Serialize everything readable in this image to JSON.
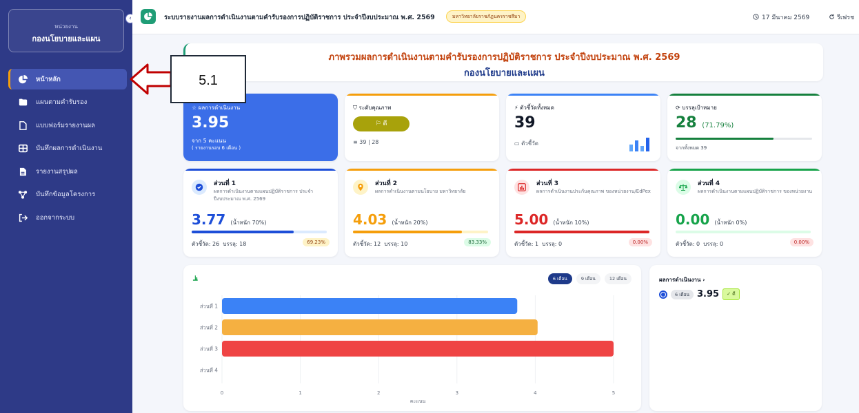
{
  "sidebar": {
    "unit_caption": "หน่วยงาน",
    "unit_name": "กองนโยบายและแผน",
    "collapse_icon": "‹",
    "items": [
      {
        "label": "หน้าหลัก",
        "icon": "pie-chart-icon",
        "active": true
      },
      {
        "label": "แผนตามคำรับรอง",
        "icon": "folder-icon"
      },
      {
        "label": "แบบฟอร์มรายงานผล",
        "icon": "document-icon"
      },
      {
        "label": "บันทึกผลการดำเนินงาน",
        "icon": "table-icon"
      },
      {
        "label": "รายงานสรุปผล",
        "icon": "report-icon"
      },
      {
        "label": "บันทึกข้อมูลโครงการ",
        "icon": "project-icon"
      },
      {
        "label": "ออกจากระบบ",
        "icon": "logout-icon"
      }
    ]
  },
  "header": {
    "title": "ระบบรายงานผลการดำเนินงานตามคำรับรองการปฏิบัติราชการ ประจำปีงบประมาณ พ.ศ. 2569",
    "university": "มหาวิทยาลัยราชภัฏนครราชสีมา",
    "date": "17 มีนาคม 2569",
    "refresh": "รีเฟรช"
  },
  "banner": {
    "line1": "ภาพรวมผลการดำเนินงานตามคำรับรองการปฏิบัติราชการ ประจำปีงบประมาณ พ.ศ. 2569",
    "line2": "กองนโยบายและแผน"
  },
  "stats": {
    "performance": {
      "label": "ผลการดำเนินงาน",
      "value": "3.95",
      "sub1": "จาก 5 คะแนน",
      "sub2": "( รายงานรอบ 6 เดือน )"
    },
    "quality": {
      "label": "ระดับคุณภาพ",
      "pill": "ดี",
      "meta": "39 | 28"
    },
    "indicators": {
      "label": "ตัวชี้วัดทั้งหมด",
      "value": "39",
      "sub": "ตัวชี้วัด"
    },
    "achieved": {
      "label": "บรรลุเป้าหมาย",
      "value": "28",
      "pct": "(71.79%)",
      "progress": 0.7179,
      "sub": "จากทั้งหมด 39"
    }
  },
  "parts": [
    {
      "title": "ส่วนที่ 1",
      "desc": "ผลการดำเนินงานตามแผนปฏิบัติราชการ ประจำปีงบประมาณ พ.ศ. 2569",
      "score": "3.77",
      "weight": "(น้ำหนัก 70%)",
      "kpi": "ตัวชี้วัด: 26",
      "met": "บรรลุ: 18",
      "pct": "69.23%",
      "progress": 0.754,
      "color": "#1d4ed8",
      "track": "#dbeafe",
      "icon": "check-circle-icon"
    },
    {
      "title": "ส่วนที่ 2",
      "desc": "ผลการดำเนินงานตามนโยบาย มหาวิทยาลัย",
      "score": "4.03",
      "weight": "(น้ำหนัก 20%)",
      "kpi": "ตัวชี้วัด: 12",
      "met": "บรรลุ: 10",
      "pct": "83.33%",
      "progress": 0.806,
      "color": "#f59e0b",
      "track": "#fef3c7",
      "icon": "location-pin-icon"
    },
    {
      "title": "ส่วนที่ 3",
      "desc": "ผลการดำเนินงานประกันคุณภาพ ของหน่วยงาน/EdPex",
      "score": "5.00",
      "weight": "(น้ำหนัก 10%)",
      "kpi": "ตัวชี้วัด: 1",
      "met": "บรรลุ: 0",
      "pct": "0.00%",
      "progress": 1.0,
      "color": "#dc2626",
      "track": "#fee2e2",
      "icon": "bar-chart-icon"
    },
    {
      "title": "ส่วนที่ 4",
      "desc": "ผลการดำเนินงานตามแผนปฏิบัติราชการ ของหน่วยงาน",
      "score": "0.00",
      "weight": "(น้ำหนัก 0%)",
      "kpi": "ตัวชี้วัด: 0",
      "met": "บรรลุ: 0",
      "pct": "0.00%",
      "progress": 0.0,
      "color": "#16a34a",
      "track": "#dcfce7",
      "icon": "scale-icon"
    }
  ],
  "chart_tabs": [
    "6 เดือน",
    "9 เดือน",
    "12 เดือน"
  ],
  "chart_data": {
    "type": "bar",
    "orientation": "horizontal",
    "categories": [
      "ส่วนที่ 1",
      "ส่วนที่ 2",
      "ส่วนที่ 3",
      "ส่วนที่ 4"
    ],
    "values": [
      3.77,
      4.03,
      5.0,
      0.0
    ],
    "colors": [
      "#3b82f6",
      "#f5b041",
      "#ef4444",
      "#16a34a"
    ],
    "xlabel": "คะแนน",
    "xlim": [
      0,
      5
    ],
    "xticks": [
      "0",
      "1",
      "2",
      "3",
      "4",
      "5"
    ],
    "grid": true
  },
  "perf_panel": {
    "title": "ผลการดำเนินงาน ›",
    "period": "6 เดือน",
    "score": "3.95",
    "level": "✓ ดี"
  },
  "annotation": {
    "label": "5.1",
    "color": "#c00000"
  }
}
